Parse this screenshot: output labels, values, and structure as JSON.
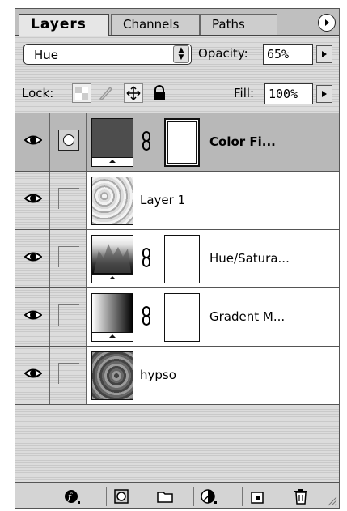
{
  "tabs": [
    {
      "label": "Layers",
      "active": true
    },
    {
      "label": "Channels",
      "active": false
    },
    {
      "label": "Paths",
      "active": false
    }
  ],
  "blend_mode": {
    "value": "Hue"
  },
  "opacity": {
    "label": "Opacity:",
    "value": "65%"
  },
  "lock": {
    "label": "Lock:"
  },
  "fill": {
    "label": "Fill:",
    "value": "100%"
  },
  "layers": [
    {
      "name": "Color Fi...",
      "selected": true,
      "thumb": "color-fill",
      "has_mask": true
    },
    {
      "name": "Layer 1",
      "selected": false,
      "thumb": "texture-light",
      "has_mask": false
    },
    {
      "name": "Hue/Satura...",
      "selected": false,
      "thumb": "histogram",
      "has_mask": true
    },
    {
      "name": "Gradent M...",
      "selected": false,
      "thumb": "gradient",
      "has_mask": true
    },
    {
      "name": "hypso",
      "selected": false,
      "thumb": "texture-dark",
      "has_mask": false
    }
  ],
  "colors": {
    "fill_swatch": "#4d4d4d",
    "selected_row": "#b8b8b8"
  },
  "icons": [
    "eye-icon",
    "chain-link-icon",
    "layer-style-icon",
    "mask-icon",
    "folder-icon",
    "adjustment-layer-icon",
    "new-layer-icon",
    "trash-icon"
  ]
}
